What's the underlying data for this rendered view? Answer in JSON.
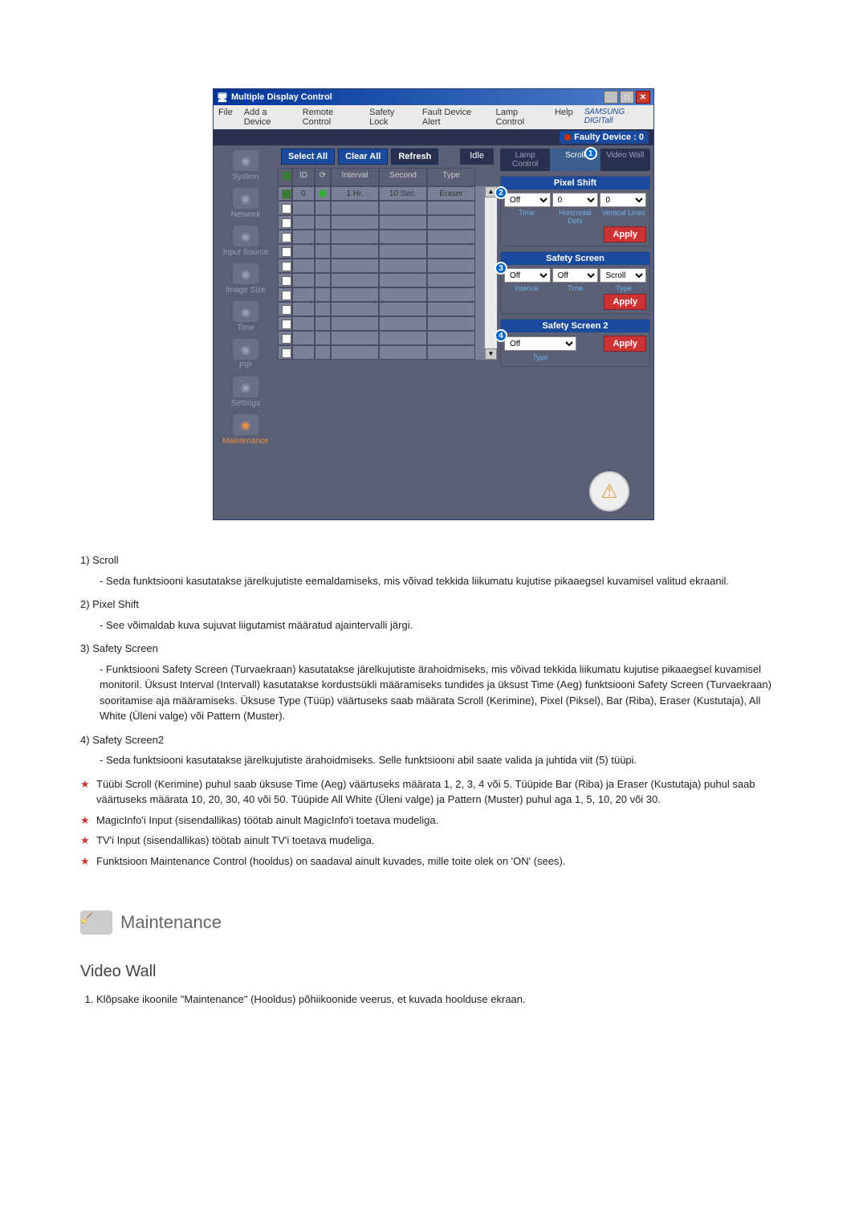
{
  "window": {
    "title": "Multiple Display Control",
    "menu": [
      "File",
      "Add a Device",
      "Remote Control",
      "Safety Lock",
      "Fault Device Alert",
      "Lamp Control",
      "Help"
    ],
    "brand": "SAMSUNG DIGITall",
    "faulty_badge": "Faulty Device : 0"
  },
  "sidebar": {
    "items": [
      {
        "label": "System"
      },
      {
        "label": "Network"
      },
      {
        "label": "Input Source"
      },
      {
        "label": "Image Size"
      },
      {
        "label": "Time"
      },
      {
        "label": "PIP"
      },
      {
        "label": "Settings"
      },
      {
        "label": "Maintenance",
        "active": true
      }
    ]
  },
  "toolbar": {
    "select_all": "Select All",
    "clear_all": "Clear All",
    "refresh": "Refresh",
    "idle": "Idle"
  },
  "table": {
    "headers": {
      "id": "ID",
      "interval": "Interval",
      "second": "Second",
      "type": "Type"
    },
    "rows": [
      {
        "checked": true,
        "id": "0",
        "dot": "g",
        "interval": "1 Hr.",
        "second": "10 Sec.",
        "type": "Eraser"
      },
      {
        "checked": false,
        "id": "",
        "dot": "",
        "interval": "",
        "second": "",
        "type": ""
      },
      {
        "checked": false,
        "id": "",
        "dot": "",
        "interval": "",
        "second": "",
        "type": ""
      },
      {
        "checked": false,
        "id": "",
        "dot": "",
        "interval": "",
        "second": "",
        "type": ""
      },
      {
        "checked": false,
        "id": "",
        "dot": "",
        "interval": "",
        "second": "",
        "type": ""
      },
      {
        "checked": false,
        "id": "",
        "dot": "",
        "interval": "",
        "second": "",
        "type": ""
      },
      {
        "checked": false,
        "id": "",
        "dot": "",
        "interval": "",
        "second": "",
        "type": ""
      },
      {
        "checked": false,
        "id": "",
        "dot": "",
        "interval": "",
        "second": "",
        "type": ""
      },
      {
        "checked": false,
        "id": "",
        "dot": "",
        "interval": "",
        "second": "",
        "type": ""
      },
      {
        "checked": false,
        "id": "",
        "dot": "",
        "interval": "",
        "second": "",
        "type": ""
      },
      {
        "checked": false,
        "id": "",
        "dot": "",
        "interval": "",
        "second": "",
        "type": ""
      },
      {
        "checked": false,
        "id": "",
        "dot": "",
        "interval": "",
        "second": "",
        "type": ""
      }
    ]
  },
  "right": {
    "tabs": [
      "Lamp Control",
      "Scroll",
      "Video Wall"
    ],
    "active_tab": 1,
    "pixel_shift": {
      "title": "Pixel Shift",
      "marker": "2",
      "off": "Off",
      "hd": "0",
      "vl": "0",
      "labels": {
        "time": "Time",
        "hd": "Horizontal Dots",
        "vl": "Vertical Lines"
      },
      "apply": "Apply"
    },
    "safety_screen": {
      "title": "Safety Screen",
      "marker": "3",
      "off": "Off",
      "interval_v": "Off",
      "type_v": "Scroll",
      "labels": {
        "interval": "Interval",
        "time": "Time",
        "type": "Type"
      },
      "apply": "Apply"
    },
    "safety_screen2": {
      "title": "Safety Screen 2",
      "marker": "4",
      "off": "Off",
      "labels": {
        "type": "Type"
      },
      "apply": "Apply"
    },
    "tab_marker": "1"
  },
  "doc": {
    "item1_title": "1) Scroll",
    "item1_body": "Seda funktsiooni kasutatakse järelkujutiste eemaldamiseks, mis võivad tekkida liikumatu kujutise pikaaegsel kuvamisel valitud ekraanil.",
    "item2_title": "2) Pixel Shift",
    "item2_body": "See võimaldab kuva sujuvat liigutamist määratud ajaintervalli järgi.",
    "item3_title": "3) Safety Screen",
    "item3_body": "Funktsiooni Safety Screen (Turvaekraan) kasutatakse järelkujutiste ärahoidmiseks, mis võivad tekkida liikumatu kujutise pikaaegsel kuvamisel monitoril. Üksust Interval (Intervall) kasutatakse kordustsükli määramiseks tundides ja üksust Time (Aeg) funktsiooni Safety Screen (Turvaekraan) sooritamise aja määramiseks. Üksuse Type (Tüüp) väärtuseks saab määrata Scroll (Kerimine), Pixel (Piksel), Bar (Riba), Eraser (Kustutaja), All White (Üleni valge) või Pattern (Muster).",
    "item4_title": "4) Safety Screen2",
    "item4_body": "Seda funktsiooni kasutatakse järelkujutiste ärahoidmiseks. Selle funktsiooni abil saate valida ja juhtida viit (5) tüüpi.",
    "star1": "Tüübi Scroll (Kerimine) puhul saab üksuse Time (Aeg) väärtuseks määrata 1, 2, 3, 4 või 5. Tüüpide Bar (Riba) ja Eraser (Kustutaja) puhul saab väärtuseks määrata 10, 20, 30, 40 või 50. Tüüpide All White (Üleni valge) ja Pattern (Muster) puhul aga 1, 5, 10, 20 või 30.",
    "star2": "MagicInfo'i Input (sisendallikas) töötab ainult MagicInfo'i toetava mudeliga.",
    "star3": "TV'i Input (sisendallikas) töötab ainult TV'i toetava mudeliga.",
    "star4": "Funktsioon Maintenance Control (hooldus) on saadaval ainult kuvades, mille toite olek on 'ON' (sees).",
    "maintenance_heading": "Maintenance",
    "videowall_heading": "Video Wall",
    "videowall_step1": "Klõpsake ikoonile \"Maintenance\" (Hooldus) põhiikoonide veerus, et kuvada hoolduse ekraan."
  }
}
